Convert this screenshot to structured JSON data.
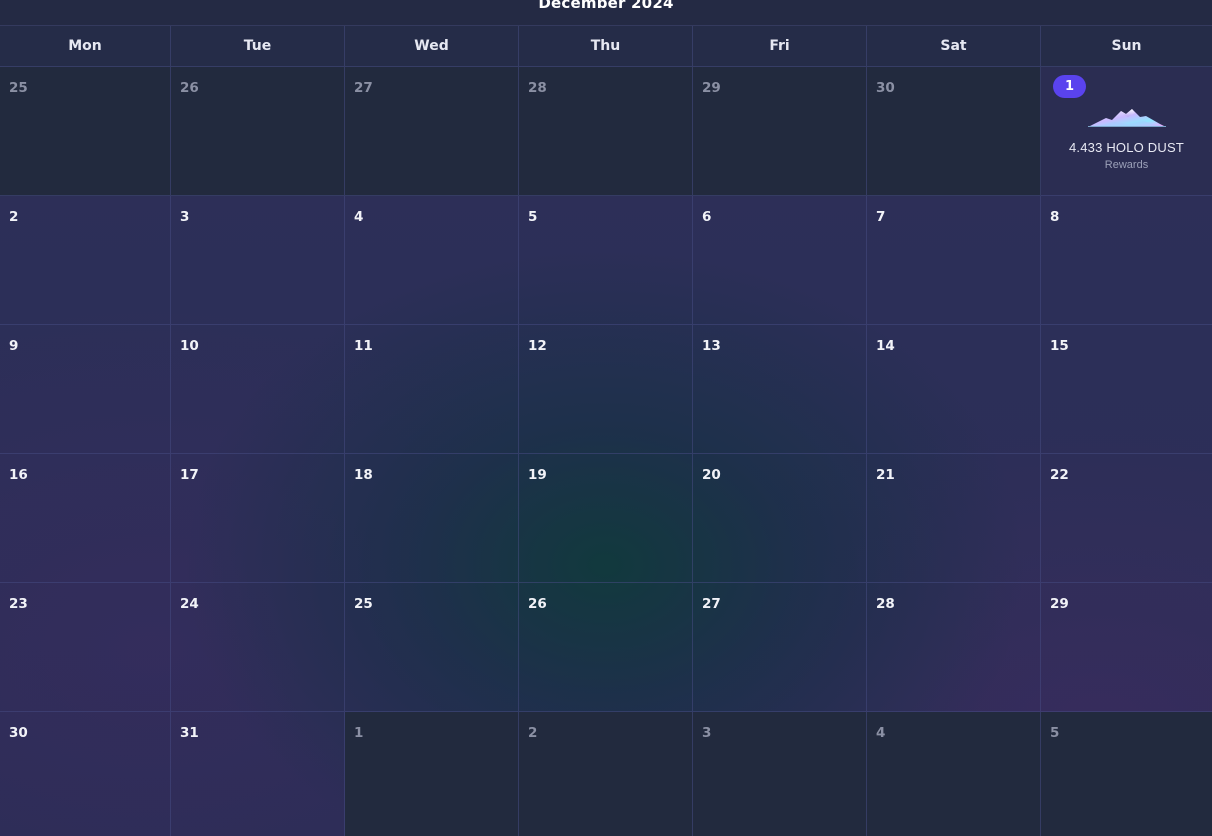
{
  "calendar": {
    "month_title": "December 2024",
    "weekdays": [
      "Mon",
      "Tue",
      "Wed",
      "Thu",
      "Fri",
      "Sat",
      "Sun"
    ],
    "weeks": [
      [
        {
          "day": "25",
          "outside": true
        },
        {
          "day": "26",
          "outside": true
        },
        {
          "day": "27",
          "outside": true
        },
        {
          "day": "28",
          "outside": true
        },
        {
          "day": "29",
          "outside": true
        },
        {
          "day": "30",
          "outside": true
        },
        {
          "day": "1",
          "outside": false,
          "today": true,
          "reward": {
            "amount": "4.433 HOLO DUST",
            "label": "Rewards",
            "icon": "holo-dust-mountain-icon"
          }
        }
      ],
      [
        {
          "day": "2"
        },
        {
          "day": "3"
        },
        {
          "day": "4"
        },
        {
          "day": "5"
        },
        {
          "day": "6"
        },
        {
          "day": "7"
        },
        {
          "day": "8"
        }
      ],
      [
        {
          "day": "9"
        },
        {
          "day": "10"
        },
        {
          "day": "11"
        },
        {
          "day": "12"
        },
        {
          "day": "13"
        },
        {
          "day": "14"
        },
        {
          "day": "15"
        }
      ],
      [
        {
          "day": "16"
        },
        {
          "day": "17"
        },
        {
          "day": "18"
        },
        {
          "day": "19"
        },
        {
          "day": "20"
        },
        {
          "day": "21"
        },
        {
          "day": "22"
        }
      ],
      [
        {
          "day": "23"
        },
        {
          "day": "24"
        },
        {
          "day": "25"
        },
        {
          "day": "26"
        },
        {
          "day": "27"
        },
        {
          "day": "28"
        },
        {
          "day": "29"
        }
      ],
      [
        {
          "day": "30"
        },
        {
          "day": "31"
        },
        {
          "day": "1",
          "outside": true
        },
        {
          "day": "2",
          "outside": true
        },
        {
          "day": "3",
          "outside": true
        },
        {
          "day": "4",
          "outside": true
        },
        {
          "day": "5",
          "outside": true
        }
      ]
    ]
  },
  "colors": {
    "today_badge": "#5a43ee",
    "outside_cell": "#222a3e",
    "text_primary": "#f2f3f8",
    "text_muted": "#8b90a4"
  }
}
